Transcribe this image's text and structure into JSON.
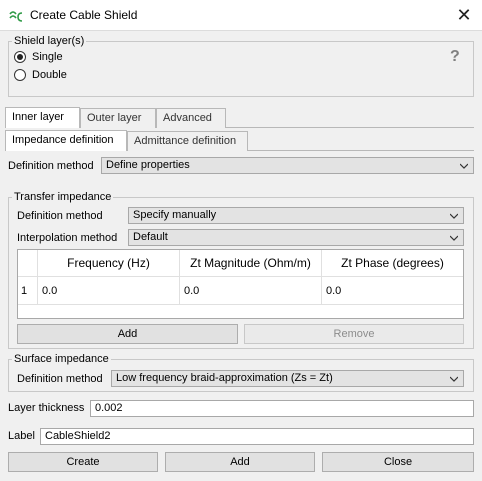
{
  "window": {
    "title": "Create Cable Shield",
    "close_glyph": "✕",
    "icon": "cable-shield-app-icon"
  },
  "shield_layers": {
    "title": "Shield layer(s)",
    "options": [
      {
        "label": "Single",
        "checked": true
      },
      {
        "label": "Double",
        "checked": false
      }
    ],
    "help_glyph": "?"
  },
  "layer_tabs": [
    {
      "label": "Inner layer",
      "active": true
    },
    {
      "label": "Outer layer",
      "active": false
    },
    {
      "label": "Advanced",
      "active": false
    }
  ],
  "definition_tabs": [
    {
      "label": "Impedance definition",
      "active": true
    },
    {
      "label": "Admittance definition",
      "active": false
    }
  ],
  "definition_method": {
    "label": "Definition method",
    "value": "Define properties"
  },
  "transfer_impedance": {
    "title": "Transfer impedance",
    "definition_method": {
      "label": "Definition method",
      "value": "Specify manually"
    },
    "interpolation_method": {
      "label": "Interpolation method",
      "value": "Default"
    },
    "table": {
      "columns": [
        "Frequency (Hz)",
        "Zt Magnitude (Ohm/m)",
        "Zt Phase (degrees)"
      ],
      "rows": [
        {
          "index": "1",
          "cells": [
            "0.0",
            "0.0",
            "0.0"
          ]
        }
      ]
    },
    "add_label": "Add",
    "remove_label": "Remove"
  },
  "surface_impedance": {
    "title": "Surface impedance",
    "definition_method": {
      "label": "Definition method",
      "value": "Low frequency braid-approximation (Zs = Zt)"
    }
  },
  "layer_thickness": {
    "label": "Layer thickness",
    "value": "0.002"
  },
  "label_field": {
    "label": "Label",
    "value": "CableShield2"
  },
  "footer": {
    "create_label": "Create",
    "add_label": "Add",
    "close_label": "Close"
  }
}
